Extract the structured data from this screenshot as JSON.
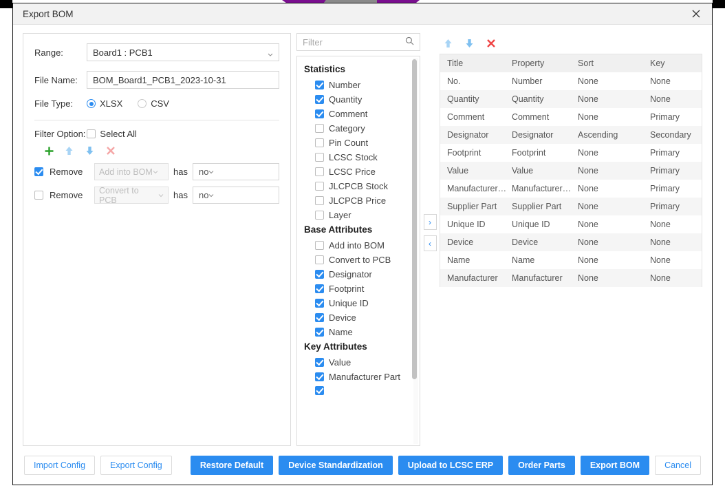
{
  "window": {
    "title": "Export BOM",
    "close_icon": "close-icon"
  },
  "form": {
    "range": {
      "label": "Range:",
      "value": "Board1 : PCB1"
    },
    "file_name": {
      "label": "File Name:",
      "value": "BOM_Board1_PCB1_2023-10-31"
    },
    "file_type": {
      "label": "File Type:",
      "options": [
        {
          "label": "XLSX",
          "selected": true
        },
        {
          "label": "CSV",
          "selected": false
        }
      ]
    }
  },
  "filter_option": {
    "label": "Filter Option:",
    "select_all": {
      "label": "Select All",
      "checked": false
    },
    "toolbar": [
      {
        "name": "add-icon",
        "glyph": "+",
        "color": "#2aa12a"
      },
      {
        "name": "move-up-icon",
        "glyph": "up",
        "color": "#a8d4f5"
      },
      {
        "name": "move-down-icon",
        "glyph": "down",
        "color": "#7fc0f0"
      },
      {
        "name": "delete-icon",
        "glyph": "x",
        "color": "#f5a6a6"
      }
    ],
    "rows": [
      {
        "checked": true,
        "remove_label": "Remove",
        "property": "Add into BOM",
        "has_label": "has",
        "value": "no"
      },
      {
        "checked": false,
        "remove_label": "Remove",
        "property": "Convert to PCB",
        "has_label": "has",
        "value": "no"
      }
    ]
  },
  "attributes": {
    "filter_placeholder": "Filter",
    "search_icon": "search-icon",
    "groups": [
      {
        "title": "Statistics",
        "items": [
          {
            "label": "Number",
            "checked": true
          },
          {
            "label": "Quantity",
            "checked": true
          },
          {
            "label": "Comment",
            "checked": true
          },
          {
            "label": "Category",
            "checked": false
          },
          {
            "label": "Pin Count",
            "checked": false
          },
          {
            "label": "LCSC Stock",
            "checked": false
          },
          {
            "label": "LCSC Price",
            "checked": false
          },
          {
            "label": "JLCPCB Stock",
            "checked": false
          },
          {
            "label": "JLCPCB Price",
            "checked": false
          },
          {
            "label": "Layer",
            "checked": false
          }
        ]
      },
      {
        "title": "Base Attributes",
        "items": [
          {
            "label": "Add into BOM",
            "checked": false
          },
          {
            "label": "Convert to PCB",
            "checked": false
          },
          {
            "label": "Designator",
            "checked": true
          },
          {
            "label": "Footprint",
            "checked": true
          },
          {
            "label": "Unique ID",
            "checked": true
          },
          {
            "label": "Device",
            "checked": true
          },
          {
            "label": "Name",
            "checked": true
          }
        ]
      },
      {
        "title": "Key Attributes",
        "items": [
          {
            "label": "Value",
            "checked": true
          },
          {
            "label": "Manufacturer Part",
            "checked": true
          }
        ]
      }
    ]
  },
  "transfer": {
    "to_right": "›",
    "to_left": "‹"
  },
  "table_toolbar": [
    {
      "name": "move-up-icon",
      "glyph": "up",
      "color": "#a8d4f5"
    },
    {
      "name": "move-down-icon",
      "glyph": "down",
      "color": "#7fc0f0"
    },
    {
      "name": "delete-icon",
      "glyph": "x",
      "color": "#ef4444"
    }
  ],
  "table": {
    "columns": [
      "Title",
      "Property",
      "Sort",
      "Key"
    ],
    "rows": [
      [
        "No.",
        "Number",
        "None",
        "None"
      ],
      [
        "Quantity",
        "Quantity",
        "None",
        "None"
      ],
      [
        "Comment",
        "Comment",
        "None",
        "Primary"
      ],
      [
        "Designator",
        "Designator",
        "Ascending",
        "Secondary"
      ],
      [
        "Footprint",
        "Footprint",
        "None",
        "Primary"
      ],
      [
        "Value",
        "Value",
        "None",
        "Primary"
      ],
      [
        "Manufacturer…",
        "Manufacturer…",
        "None",
        "Primary"
      ],
      [
        "Supplier Part",
        "Supplier Part",
        "None",
        "Primary"
      ],
      [
        "Unique ID",
        "Unique ID",
        "None",
        "None"
      ],
      [
        "Device",
        "Device",
        "None",
        "None"
      ],
      [
        "Name",
        "Name",
        "None",
        "None"
      ],
      [
        "Manufacturer",
        "Manufacturer",
        "None",
        "None"
      ]
    ]
  },
  "footer": {
    "left": [
      {
        "label": "Import Config",
        "style": "light"
      },
      {
        "label": "Export Config",
        "style": "light"
      }
    ],
    "right": [
      {
        "label": "Restore Default",
        "style": "primary"
      },
      {
        "label": "Device Standardization",
        "style": "primary"
      },
      {
        "label": "Upload to LCSC ERP",
        "style": "primary"
      },
      {
        "label": "Order Parts",
        "style": "primary"
      },
      {
        "label": "Export BOM",
        "style": "primary"
      },
      {
        "label": "Cancel",
        "style": "light"
      }
    ]
  },
  "colors": {
    "accent": "#2b8cf0",
    "green": "#2aa12a",
    "red": "#ef4444",
    "header_bg": "#f0f0f0"
  }
}
